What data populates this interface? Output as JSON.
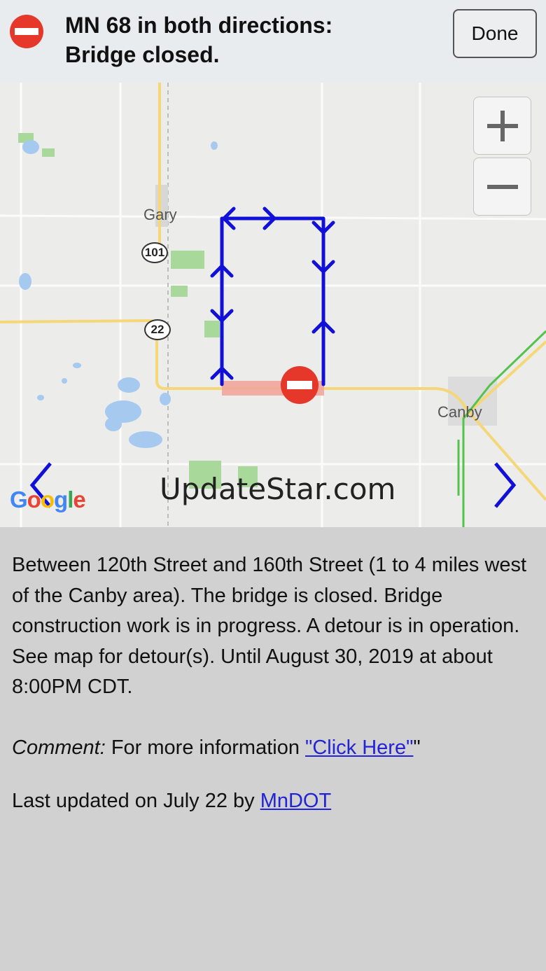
{
  "header": {
    "icon": "no-entry-icon",
    "title_line1": "MN 68 in both directions:",
    "title_line2": "Bridge closed.",
    "done_label": "Done"
  },
  "map": {
    "places": {
      "gary": "Gary",
      "canby": "Canby"
    },
    "shields": {
      "route_101": "101",
      "route_22": "22"
    },
    "zoom_in_icon": "plus-icon",
    "zoom_out_icon": "minus-icon",
    "prev_icon": "chevron-left-icon",
    "next_icon": "chevron-right-icon",
    "detour_color": "#1010d8",
    "closure_color": "#e6372b",
    "watermark": "UpdateStar.com",
    "google_letters": [
      "G",
      "o",
      "o",
      "g",
      "l",
      "e"
    ]
  },
  "details": {
    "description": "Between 120th Street and 160th Street (1 to 4 miles west of the Canby area). The bridge is closed. Bridge construction work is in progress. A detour is in operation. See map for detour(s). Until August 30, 2019 at about 8:00PM CDT.",
    "comment_label": "Comment:",
    "comment_text": "For more information",
    "comment_link": "\"Click Here\"",
    "comment_suffix": "\"",
    "updated_prefix": "Last updated on July 22 by",
    "updated_link": "MnDOT"
  }
}
